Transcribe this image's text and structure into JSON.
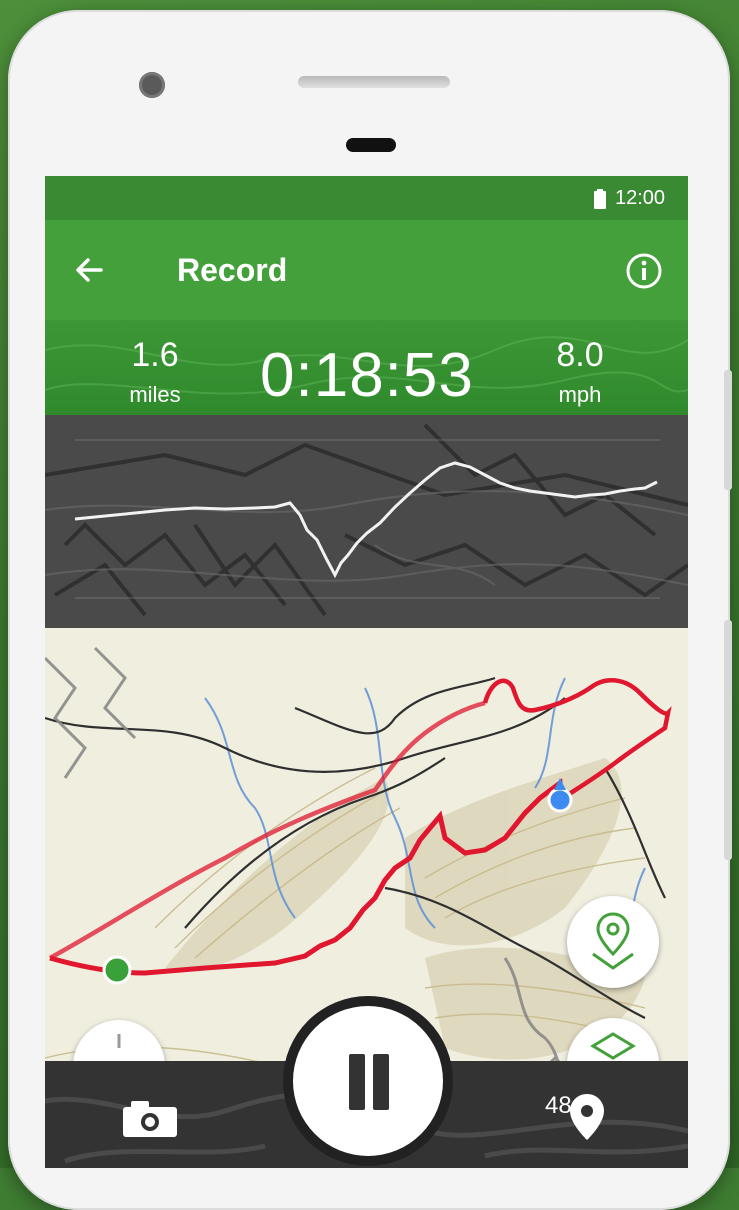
{
  "status_bar": {
    "time": "12:00",
    "battery_icon": "battery-full-icon"
  },
  "app_bar": {
    "title": "Record",
    "back_icon": "arrow-back-icon",
    "info_icon": "info-icon"
  },
  "stats": {
    "distance": {
      "value": "1.6",
      "unit": "miles"
    },
    "elapsed_time": "0:18:53",
    "speed": {
      "value": "8.0",
      "unit": "mph"
    }
  },
  "colors": {
    "accent": "#43a03b",
    "status_bar": "#3a8a33",
    "track": "#e0172f",
    "start_marker": "#3aa03a",
    "location_dot": "#3d8bf0"
  },
  "controls": {
    "waypoint_fab_icon": "location-pin-plane-icon",
    "pause_icon": "pause-icon",
    "camera_icon": "camera-icon",
    "map_pin_icon": "map-pin-icon"
  },
  "overlay_text": "48"
}
